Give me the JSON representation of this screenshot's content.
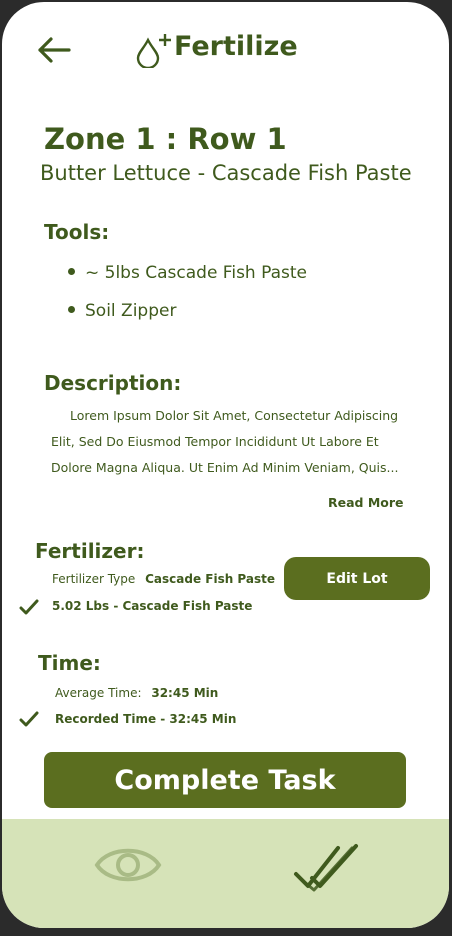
{
  "header": {
    "title": "Fertilize",
    "back_icon": "arrow-left-icon",
    "title_icon": "droplet-plus-icon"
  },
  "zone": {
    "title": "Zone 1 : Row 1",
    "subtitle": "Butter Lettuce - Cascade Fish Paste"
  },
  "tools": {
    "heading": "Tools:",
    "items": [
      "~ 5lbs Cascade Fish Paste",
      "Soil Zipper"
    ]
  },
  "description": {
    "heading": "Description:",
    "lines": [
      "Lorem Ipsum Dolor Sit Amet, Consectetur Adipiscing",
      "Elit, Sed Do Eiusmod Tempor Incididunt Ut Labore Et",
      "Dolore Magna Aliqua. Ut Enim Ad Minim Veniam, Quis..."
    ],
    "read_more": "Read More"
  },
  "fertilizer": {
    "heading": "Fertilizer:",
    "type_label": "Fertilizer Type",
    "type_value": "Cascade Fish Paste",
    "edit_button": "Edit Lot",
    "recorded": "5.02 Lbs - Cascade Fish Paste"
  },
  "time": {
    "heading": "Time:",
    "average_label": "Average Time:",
    "average_value": "32:45 Min",
    "recorded": "Recorded Time - 32:45 Min"
  },
  "complete_button": "Complete Task",
  "bottom_nav": {
    "left_icon": "eye-icon",
    "right_icon": "double-check-icon"
  },
  "colors": {
    "primary": "#5b6e1f",
    "text": "#3f5a1d",
    "nav_bg": "#d6e3b8",
    "eye": "#a9bb86"
  }
}
